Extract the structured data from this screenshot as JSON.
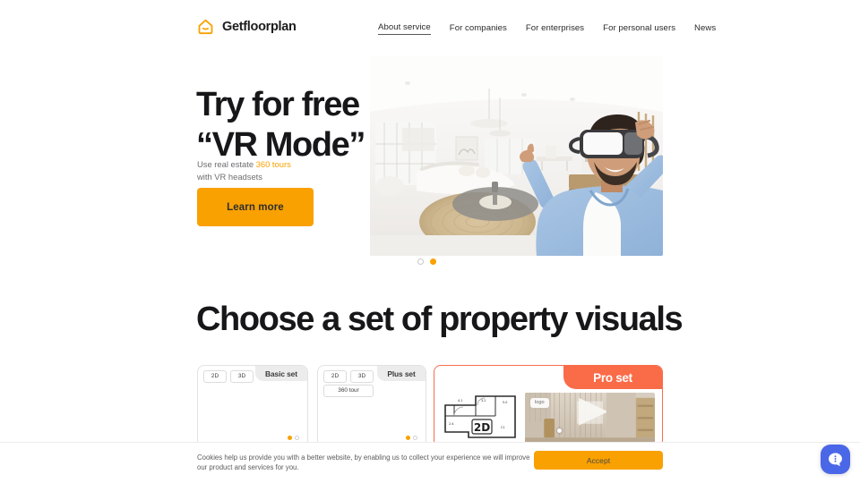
{
  "brand": {
    "name": "Getfloorplan",
    "icon": "home-smile-icon",
    "color": "#F9A100"
  },
  "nav": {
    "items": [
      {
        "label": "About service",
        "active": true
      },
      {
        "label": "For companies",
        "active": false
      },
      {
        "label": "For enterprises",
        "active": false
      },
      {
        "label": "For personal users",
        "active": false
      },
      {
        "label": "News",
        "active": false
      }
    ]
  },
  "hero": {
    "title": "Try for free\n“VR Mode”",
    "subtitle_before": "Use real estate ",
    "subtitle_highlight": "360 tours",
    "subtitle_after": "with VR headsets",
    "cta_label": "Learn more",
    "cta_color": "#F9A100",
    "image_alt": "man-wearing-vr-headset-in-living-room",
    "carousel": {
      "total": 2,
      "active_index": 2,
      "dots": [
        "inactive",
        "active"
      ]
    }
  },
  "section": {
    "title": "Choose a set of property visuals"
  },
  "cards": [
    {
      "tab_label": "Basic set",
      "tab_color": "#ECECEC",
      "chips": [
        "2D",
        "3D"
      ],
      "chips_row2": [],
      "media_alt": "2d-floorplan-top-view",
      "mini_dots": [
        "active",
        "inactive"
      ]
    },
    {
      "tab_label": "Plus set",
      "tab_color": "#ECECEC",
      "chips": [
        "2D",
        "3D"
      ],
      "chips_row2": [
        "360 tour"
      ],
      "media_alt": "3d-living-room-render",
      "mini_dots": [
        "active",
        "inactive"
      ]
    },
    {
      "tab_label": "Pro set",
      "tab_color": "#FA6B48",
      "chips": [],
      "chips_row2": [],
      "plan_label": "2D",
      "logo_badge": "logo",
      "media_alt": "2d-blueprint-and-360-interior-tour",
      "mini_dots": []
    }
  ],
  "cookie": {
    "text": "Cookies help us provide you with a better website, by enabling us to collect your experience we will improve our product and services for you.",
    "accept_label": "Accept",
    "accept_color": "#F9A100"
  },
  "chat": {
    "icon": "chat-bubble-dots-icon",
    "color": "#4A67E8"
  }
}
